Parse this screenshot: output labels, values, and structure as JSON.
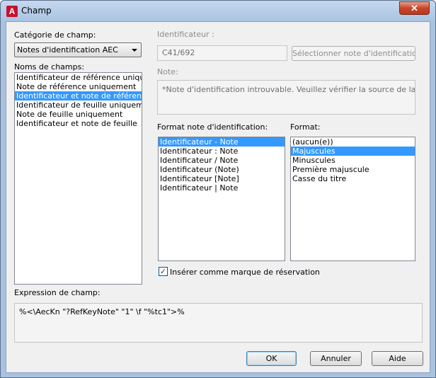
{
  "window": {
    "title": "Champ",
    "app_icon": "autocad-a-icon",
    "close_symbol": "✕"
  },
  "category": {
    "label": "Catégorie de champ:",
    "selected": "Notes d'identification AEC"
  },
  "field_names": {
    "label": "Noms de champs:",
    "items": [
      "Identificateur de référence uniquement",
      "Note de référence uniquement",
      "Identificateur et note de référence",
      "Identificateur de feuille uniquement",
      "Note de feuille uniquement",
      "Identificateur et note de feuille"
    ],
    "selected_index": 2
  },
  "identifier": {
    "label": "Identificateur :",
    "value": "C41/692",
    "select_button": "Sélectionner note d'identification..."
  },
  "note": {
    "label": "Note:",
    "value": "*Note d'identification introuvable. Veuillez vérifier la source de la base de données"
  },
  "keynote_format": {
    "label": "Format note d'identification:",
    "items": [
      "Identificateur - Note",
      "Identificateur : Note",
      "Identificateur / Note",
      "Identificateur (Note)",
      "Identificateur [Note]",
      "Identificateur | Note"
    ],
    "selected_index": 0
  },
  "format": {
    "label": "Format:",
    "items": [
      "(aucun(e))",
      "Majuscules",
      "Minuscules",
      "Première majuscule",
      "Casse du titre"
    ],
    "selected_index": 1
  },
  "placeholder_checkbox": {
    "label": "Insérer comme marque de réservation",
    "checked": true,
    "check_symbol": "✓"
  },
  "expression": {
    "label": "Expression de champ:",
    "value": "%<\\AecKn \"?RefKeyNote\" \"1\" \\f \"%tc1\">%"
  },
  "buttons": {
    "ok": "OK",
    "cancel": "Annuler",
    "help": "Aide"
  },
  "colors": {
    "selection": "#3399ff",
    "title_bar": "#a9c4e3",
    "close_button": "#c7452a"
  }
}
